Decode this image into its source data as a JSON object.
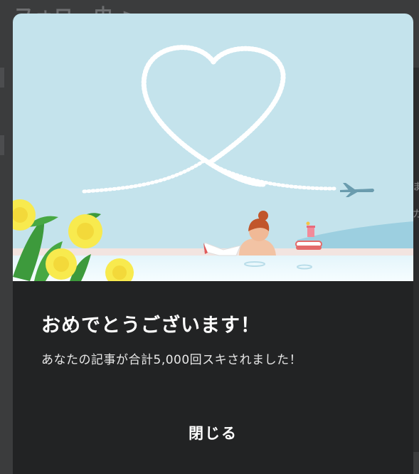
{
  "background": {
    "title": "フォロー中 >",
    "edge_chars": [
      "ま",
      "ガ"
    ]
  },
  "modal": {
    "title": "おめでとうございます！",
    "message": "あなたの記事が合計5,000回スキされました！",
    "close_label": "閉じる",
    "colors": {
      "panel": "#222324",
      "sky": "#c4e3ec",
      "pool": "#eef9fd",
      "flower": "#f8ea4e",
      "leaf": "#3d9a3c"
    }
  }
}
